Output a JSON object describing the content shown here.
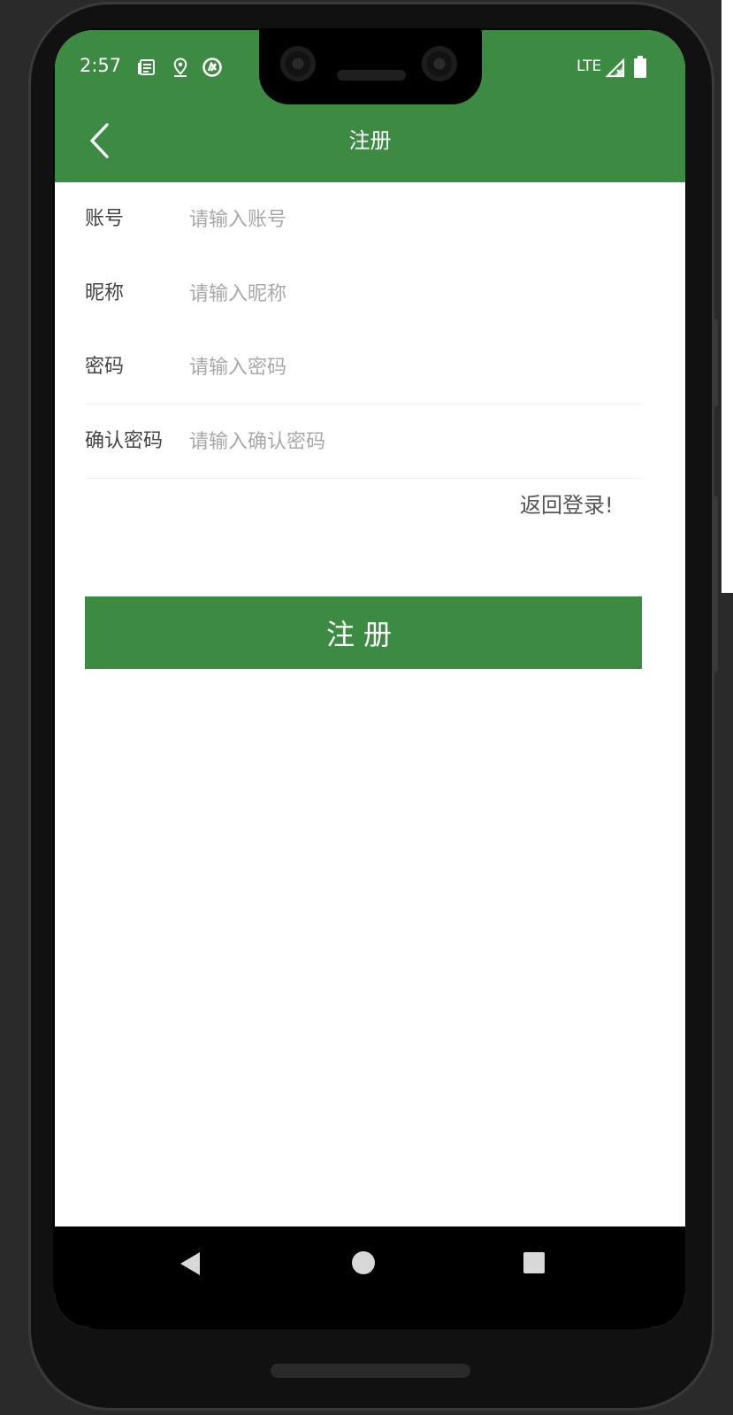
{
  "status_bar": {
    "time": "2:57",
    "network": "LTE",
    "icons": [
      "news-icon",
      "location-pin-icon",
      "sync-icon",
      "signal-icon",
      "battery-icon"
    ]
  },
  "app_bar": {
    "title": "注册",
    "back_icon": "chevron-left-icon"
  },
  "form": {
    "fields": [
      {
        "label": "账号",
        "placeholder": "请输入账号",
        "value": ""
      },
      {
        "label": "昵称",
        "placeholder": "请输入昵称",
        "value": ""
      },
      {
        "label": "密码",
        "placeholder": "请输入密码",
        "value": ""
      },
      {
        "label": "确认密码",
        "placeholder": "请输入确认密码",
        "value": ""
      }
    ],
    "back_to_login": "返回登录!",
    "submit_label": "注册"
  },
  "nav_bar": {
    "icons": [
      "nav-back-icon",
      "nav-home-icon",
      "nav-recents-icon"
    ]
  },
  "colors": {
    "primary": "#3d8a42",
    "background": "#ffffff",
    "label_text": "#444444",
    "placeholder_text": "#a8a8a8"
  }
}
